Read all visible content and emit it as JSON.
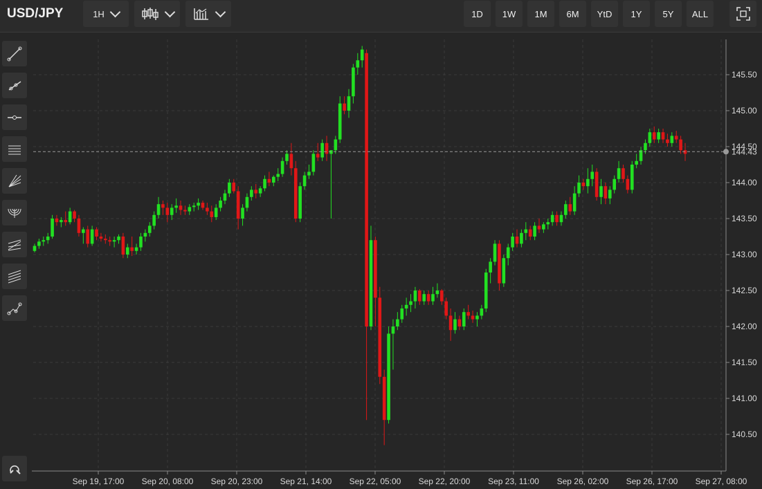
{
  "header": {
    "symbol": "USD/JPY",
    "interval": "1H",
    "ranges": [
      "1D",
      "1W",
      "1M",
      "6M",
      "YtD",
      "1Y",
      "5Y",
      "ALL"
    ]
  },
  "toolbar_icons": [
    "candlestick-icon",
    "chart-style-icon",
    "fullscreen-icon"
  ],
  "sidebar_tools": [
    "trend-line-icon",
    "ray-icon",
    "horizontal-line-icon",
    "parallel-channel-icon",
    "fan-icon",
    "arc-icon",
    "pitchfork-icon",
    "fibonacci-icon",
    "path-icon",
    "magnet-icon"
  ],
  "colors": {
    "up": "#22e022",
    "down": "#e01717",
    "background": "#262626",
    "grid": "#3a3a3a"
  },
  "chart_data": {
    "type": "candlestick",
    "y_ticks": [
      "140.50",
      "141.00",
      "141.50",
      "142.00",
      "142.50",
      "143.00",
      "143.50",
      "144.00",
      "144.50",
      "145.00",
      "145.50"
    ],
    "x_ticks": [
      "Sep 19, 17:00",
      "Sep 20, 08:00",
      "Sep 20, 23:00",
      "Sep 21, 14:00",
      "Sep 22, 05:00",
      "Sep 22, 20:00",
      "Sep 23, 11:00",
      "Sep 26, 02:00",
      "Sep 26, 17:00",
      "Sep 27, 08:00"
    ],
    "ylim": [
      140.0,
      146.2
    ],
    "last_price": "144.43",
    "candles": [
      [
        143.05,
        143.15,
        143.03,
        143.12
      ],
      [
        143.12,
        143.22,
        143.08,
        143.18
      ],
      [
        143.18,
        143.25,
        143.12,
        143.2
      ],
      [
        143.2,
        143.3,
        143.15,
        143.25
      ],
      [
        143.25,
        143.55,
        143.22,
        143.5
      ],
      [
        143.5,
        143.55,
        143.4,
        143.45
      ],
      [
        143.45,
        143.52,
        143.38,
        143.48
      ],
      [
        143.48,
        143.6,
        143.4,
        143.45
      ],
      [
        143.45,
        143.65,
        143.42,
        143.6
      ],
      [
        143.6,
        143.62,
        143.45,
        143.5
      ],
      [
        143.5,
        143.55,
        143.25,
        143.3
      ],
      [
        143.3,
        143.38,
        143.15,
        143.35
      ],
      [
        143.35,
        143.4,
        143.1,
        143.15
      ],
      [
        143.15,
        143.4,
        143.12,
        143.35
      ],
      [
        143.35,
        143.38,
        143.2,
        143.25
      ],
      [
        143.25,
        143.3,
        143.18,
        143.22
      ],
      [
        143.22,
        143.28,
        143.15,
        143.2
      ],
      [
        143.2,
        143.25,
        143.12,
        143.18
      ],
      [
        143.18,
        143.25,
        143.1,
        143.2
      ],
      [
        143.2,
        143.28,
        143.15,
        143.25
      ],
      [
        143.25,
        143.3,
        142.95,
        143.0
      ],
      [
        143.0,
        143.15,
        142.95,
        143.1
      ],
      [
        143.1,
        143.25,
        142.98,
        143.05
      ],
      [
        143.05,
        143.15,
        143.0,
        143.1
      ],
      [
        143.1,
        143.3,
        143.05,
        143.25
      ],
      [
        143.25,
        143.35,
        143.18,
        143.3
      ],
      [
        143.3,
        143.45,
        143.25,
        143.4
      ],
      [
        143.4,
        143.6,
        143.35,
        143.55
      ],
      [
        143.55,
        143.8,
        143.5,
        143.7
      ],
      [
        143.7,
        143.75,
        143.55,
        143.65
      ],
      [
        143.65,
        143.72,
        143.45,
        143.55
      ],
      [
        143.55,
        143.7,
        143.48,
        143.65
      ],
      [
        143.65,
        143.78,
        143.58,
        143.68
      ],
      [
        143.68,
        143.75,
        143.55,
        143.62
      ],
      [
        143.62,
        143.68,
        143.55,
        143.6
      ],
      [
        143.6,
        143.7,
        143.55,
        143.66
      ],
      [
        143.66,
        143.72,
        143.6,
        143.68
      ],
      [
        143.68,
        143.78,
        143.62,
        143.72
      ],
      [
        143.72,
        143.75,
        143.62,
        143.65
      ],
      [
        143.65,
        143.72,
        143.55,
        143.6
      ],
      [
        143.6,
        143.68,
        143.45,
        143.52
      ],
      [
        143.52,
        143.7,
        143.48,
        143.65
      ],
      [
        143.65,
        143.8,
        143.6,
        143.75
      ],
      [
        143.75,
        143.9,
        143.7,
        143.85
      ],
      [
        143.85,
        144.05,
        143.8,
        144.0
      ],
      [
        144.0,
        144.05,
        143.85,
        143.88
      ],
      [
        143.88,
        143.95,
        143.35,
        143.5
      ],
      [
        143.5,
        143.7,
        143.4,
        143.65
      ],
      [
        143.65,
        143.85,
        143.6,
        143.8
      ],
      [
        143.8,
        143.95,
        143.75,
        143.9
      ],
      [
        143.9,
        143.98,
        143.78,
        143.85
      ],
      [
        143.85,
        143.95,
        143.8,
        143.92
      ],
      [
        143.92,
        144.1,
        143.88,
        144.05
      ],
      [
        144.05,
        144.15,
        143.95,
        144.0
      ],
      [
        144.0,
        144.1,
        143.95,
        144.08
      ],
      [
        144.08,
        144.2,
        144.02,
        144.12
      ],
      [
        144.12,
        144.35,
        144.08,
        144.3
      ],
      [
        144.3,
        144.45,
        144.25,
        144.4
      ],
      [
        144.4,
        144.55,
        144.1,
        144.2
      ],
      [
        144.2,
        144.3,
        143.45,
        143.5
      ],
      [
        143.5,
        144.0,
        143.45,
        143.95
      ],
      [
        143.95,
        144.15,
        143.9,
        144.1
      ],
      [
        144.1,
        144.25,
        144.05,
        144.15
      ],
      [
        144.15,
        144.45,
        144.1,
        144.4
      ],
      [
        144.4,
        144.55,
        144.3,
        144.35
      ],
      [
        144.35,
        144.6,
        144.3,
        144.55
      ],
      [
        144.55,
        144.65,
        144.3,
        144.4
      ],
      [
        144.4,
        144.45,
        143.5,
        144.45
      ],
      [
        144.45,
        144.65,
        144.4,
        144.6
      ],
      [
        144.6,
        145.2,
        144.55,
        145.1
      ],
      [
        145.1,
        145.2,
        144.95,
        145.0
      ],
      [
        145.0,
        145.3,
        144.9,
        145.2
      ],
      [
        145.2,
        145.65,
        145.1,
        145.6
      ],
      [
        145.6,
        145.8,
        145.5,
        145.7
      ],
      [
        145.7,
        145.9,
        145.6,
        145.85
      ],
      [
        145.8,
        145.85,
        140.7,
        142.0
      ],
      [
        142.0,
        143.4,
        141.95,
        143.2
      ],
      [
        143.2,
        143.25,
        142.0,
        142.4
      ],
      [
        142.4,
        142.55,
        141.2,
        141.3
      ],
      [
        141.3,
        141.4,
        140.35,
        140.7
      ],
      [
        140.7,
        142.0,
        140.65,
        141.9
      ],
      [
        141.9,
        142.1,
        141.4,
        142.0
      ],
      [
        142.0,
        142.2,
        141.95,
        142.1
      ],
      [
        142.1,
        142.3,
        142.05,
        142.25
      ],
      [
        142.25,
        142.4,
        142.15,
        142.3
      ],
      [
        142.3,
        142.45,
        142.2,
        142.35
      ],
      [
        142.35,
        142.55,
        142.25,
        142.5
      ],
      [
        142.5,
        142.52,
        142.3,
        142.35
      ],
      [
        142.35,
        142.5,
        142.3,
        142.45
      ],
      [
        142.45,
        142.5,
        142.3,
        142.35
      ],
      [
        142.35,
        142.55,
        142.3,
        142.45
      ],
      [
        142.45,
        142.6,
        142.4,
        142.5
      ],
      [
        142.5,
        142.52,
        142.3,
        142.35
      ],
      [
        142.35,
        142.4,
        142.1,
        142.15
      ],
      [
        142.15,
        142.25,
        141.8,
        141.95
      ],
      [
        141.95,
        142.2,
        141.9,
        142.1
      ],
      [
        142.1,
        142.15,
        141.95,
        142.0
      ],
      [
        142.0,
        142.25,
        141.95,
        142.2
      ],
      [
        142.2,
        142.3,
        142.1,
        142.15
      ],
      [
        142.15,
        142.22,
        142.05,
        142.1
      ],
      [
        142.1,
        142.2,
        142.0,
        142.15
      ],
      [
        142.15,
        142.3,
        142.1,
        142.25
      ],
      [
        142.25,
        142.8,
        142.2,
        142.75
      ],
      [
        142.75,
        142.95,
        142.6,
        142.9
      ],
      [
        142.9,
        143.2,
        142.85,
        143.15
      ],
      [
        143.15,
        143.2,
        142.5,
        142.6
      ],
      [
        142.6,
        143.0,
        142.55,
        142.95
      ],
      [
        142.95,
        143.15,
        142.85,
        143.1
      ],
      [
        143.1,
        143.3,
        143.05,
        143.25
      ],
      [
        143.25,
        143.35,
        143.1,
        143.15
      ],
      [
        143.15,
        143.35,
        143.1,
        143.3
      ],
      [
        143.3,
        143.45,
        143.2,
        143.35
      ],
      [
        143.35,
        143.4,
        143.2,
        143.25
      ],
      [
        143.25,
        143.45,
        143.2,
        143.4
      ],
      [
        143.4,
        143.5,
        143.3,
        143.35
      ],
      [
        143.35,
        143.45,
        143.3,
        143.42
      ],
      [
        143.42,
        143.5,
        143.35,
        143.45
      ],
      [
        143.45,
        143.6,
        143.4,
        143.55
      ],
      [
        143.55,
        143.6,
        143.4,
        143.45
      ],
      [
        143.45,
        143.6,
        143.4,
        143.55
      ],
      [
        143.55,
        143.75,
        143.5,
        143.7
      ],
      [
        143.7,
        143.8,
        143.55,
        143.6
      ],
      [
        143.6,
        143.95,
        143.55,
        143.85
      ],
      [
        143.85,
        144.1,
        143.8,
        144.0
      ],
      [
        144.0,
        144.05,
        143.9,
        143.95
      ],
      [
        143.95,
        144.2,
        143.85,
        144.05
      ],
      [
        144.05,
        144.25,
        143.95,
        144.15
      ],
      [
        144.15,
        144.2,
        143.75,
        143.8
      ],
      [
        143.8,
        144.05,
        143.7,
        143.95
      ],
      [
        143.95,
        144.0,
        143.7,
        143.78
      ],
      [
        143.78,
        143.95,
        143.7,
        143.9
      ],
      [
        143.9,
        144.1,
        143.85,
        144.05
      ],
      [
        144.05,
        144.3,
        144.0,
        144.2
      ],
      [
        144.2,
        144.25,
        144.0,
        144.05
      ],
      [
        144.05,
        144.1,
        143.85,
        143.9
      ],
      [
        143.9,
        144.3,
        143.85,
        144.25
      ],
      [
        144.25,
        144.4,
        144.2,
        144.3
      ],
      [
        144.3,
        144.5,
        144.25,
        144.45
      ],
      [
        144.45,
        144.6,
        144.4,
        144.55
      ],
      [
        144.55,
        144.75,
        144.5,
        144.7
      ],
      [
        144.7,
        144.78,
        144.55,
        144.6
      ],
      [
        144.6,
        144.75,
        144.55,
        144.7
      ],
      [
        144.7,
        144.75,
        144.55,
        144.6
      ],
      [
        144.6,
        144.68,
        144.5,
        144.55
      ],
      [
        144.55,
        144.7,
        144.5,
        144.65
      ],
      [
        144.65,
        144.72,
        144.55,
        144.6
      ],
      [
        144.6,
        144.65,
        144.4,
        144.45
      ],
      [
        144.45,
        144.55,
        144.3,
        144.4
      ]
    ]
  }
}
